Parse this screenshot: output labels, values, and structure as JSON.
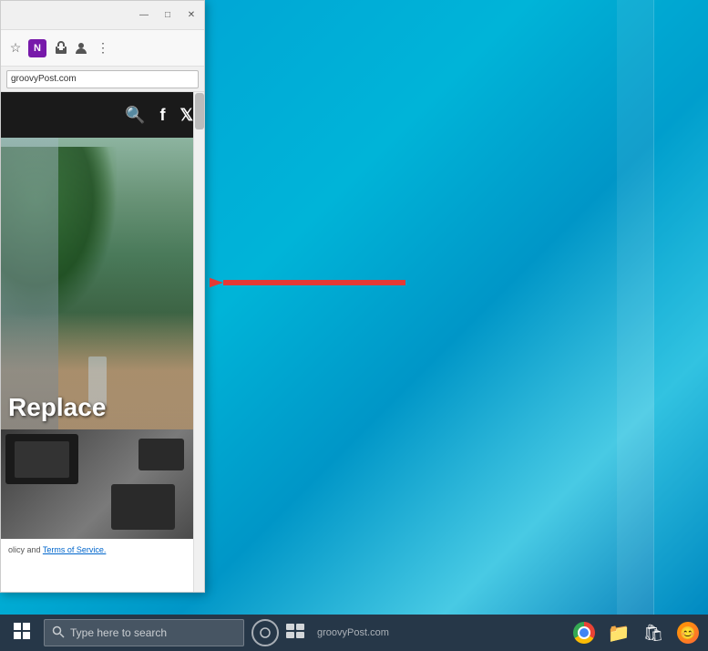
{
  "desktop": {
    "background_color": "#009fd4"
  },
  "browser": {
    "title": "groovyPost",
    "url": "groovyPost.com",
    "title_bar": {
      "minimize_label": "—",
      "maximize_label": "□",
      "close_label": "✕"
    },
    "toolbar": {
      "bookmark_icon": "☆",
      "extensions_icon": "⊞",
      "account_icon": "○",
      "menu_icon": "⋮"
    },
    "site_header": {
      "search_icon": "🔍",
      "facebook_icon": "f",
      "twitter_icon": "𝕏"
    },
    "content": {
      "hero_text": "Replace",
      "footer_text": "olicy and ",
      "footer_link_terms": "Terms of Service.",
      "second_image_alt": "workspace with tablet and laptop"
    }
  },
  "taskbar": {
    "start_icon": "⊞",
    "search_placeholder": "Type here to search",
    "domain": "groovyPost.com",
    "cortana_icon": "○",
    "task_view_icon": "⧉",
    "system_icons": {
      "chrome": "chrome",
      "folder": "📁",
      "store": "🛍",
      "avatar": "😊"
    }
  },
  "arrow": {
    "color": "#e53935",
    "direction": "left"
  }
}
